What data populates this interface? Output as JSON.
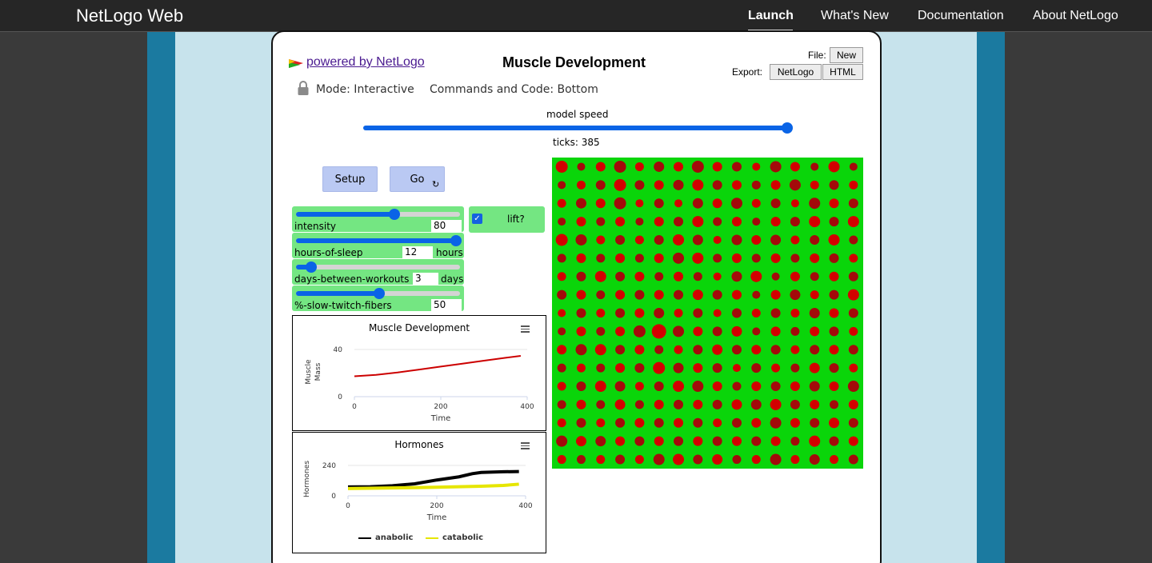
{
  "navbar": {
    "brand": "NetLogo Web",
    "links": [
      "Launch",
      "What's New",
      "Documentation",
      "About NetLogo"
    ]
  },
  "header": {
    "powered_by": "powered by NetLogo",
    "title": "Muscle Development",
    "file_label": "File:",
    "new_button": "New",
    "export_label": "Export:",
    "export_netlogo": "NetLogo",
    "export_html": "HTML",
    "mode": "Mode: Interactive",
    "commands": "Commands and Code: Bottom"
  },
  "speed": {
    "label": "model speed",
    "ticks": "ticks: 385",
    "value": 1.0
  },
  "buttons": {
    "setup": "Setup",
    "go": "Go",
    "go_icon": "forever-icon"
  },
  "sliders": [
    {
      "name": "intensity",
      "value": "80",
      "units": "",
      "fraction": 0.6
    },
    {
      "name": "hours-of-sleep",
      "value": "12",
      "units": "hours",
      "fraction": 1.0
    },
    {
      "name": "days-between-workouts",
      "value": "3",
      "units": "days",
      "fraction": 0.1
    },
    {
      "name": "%-slow-twitch-fibers",
      "value": "50",
      "units": "",
      "fraction": 0.5
    }
  ],
  "switch": {
    "label": "lift?",
    "checked": true
  },
  "plots": {
    "muscle": {
      "title": "Muscle Development",
      "ylabel_line1": "Muscle",
      "ylabel_line2": "Mass",
      "xlabel": "Time",
      "y_ticks": [
        "40",
        "0"
      ],
      "x_ticks": [
        "0",
        "200",
        "400"
      ]
    },
    "hormones": {
      "title": "Hormones",
      "ylabel": "Hormones",
      "xlabel": "Time",
      "y_ticks": [
        "240",
        "0"
      ],
      "x_ticks": [
        "0",
        "200",
        "400"
      ],
      "legend": [
        "anabolic",
        "catabolic"
      ]
    }
  },
  "chart_data": [
    {
      "type": "line",
      "title": "Muscle Development",
      "xlabel": "Time",
      "ylabel": "Muscle Mass",
      "xlim": [
        0,
        400
      ],
      "ylim": [
        0,
        40
      ],
      "series": [
        {
          "color": "#cc0000",
          "x": [
            0,
            50,
            100,
            150,
            200,
            250,
            300,
            350,
            385
          ],
          "y": [
            17.3,
            18.5,
            20.5,
            23,
            25.5,
            28,
            30.5,
            33,
            34.6
          ]
        }
      ]
    },
    {
      "type": "line",
      "title": "Hormones",
      "xlabel": "Time",
      "ylabel": "Hormones",
      "xlim": [
        0,
        400
      ],
      "ylim": [
        0,
        240
      ],
      "series": [
        {
          "name": "anabolic",
          "color": "#000000",
          "x": [
            0,
            50,
            100,
            150,
            200,
            250,
            280,
            300,
            350,
            385
          ],
          "y": [
            70,
            72,
            80,
            95,
            125,
            150,
            175,
            185,
            190,
            192
          ]
        },
        {
          "name": "catabolic",
          "color": "#e6e600",
          "x": [
            0,
            50,
            100,
            150,
            200,
            250,
            300,
            350,
            385
          ],
          "y": [
            58,
            60,
            62,
            65,
            68,
            72,
            76,
            82,
            92
          ]
        }
      ]
    }
  ],
  "view": {
    "background": "#0ad50a",
    "colors": [
      "#d30000",
      "#a30a0a"
    ],
    "sizes": [
      [
        15,
        10,
        12,
        15,
        11,
        13,
        12,
        15,
        12,
        12,
        10,
        14,
        12,
        10,
        14,
        10
      ],
      [
        10,
        11,
        12,
        15,
        12,
        12,
        13,
        14,
        12,
        12,
        11,
        12,
        14,
        11,
        12,
        11
      ],
      [
        11,
        13,
        12,
        15,
        10,
        12,
        10,
        13,
        12,
        14,
        11,
        12,
        10,
        14,
        12,
        12
      ],
      [
        10,
        12,
        11,
        12,
        10,
        12,
        12,
        14,
        11,
        12,
        10,
        12,
        12,
        14,
        12,
        14
      ],
      [
        15,
        14,
        11,
        12,
        11,
        12,
        14,
        13,
        10,
        13,
        12,
        13,
        11,
        12,
        14,
        11
      ],
      [
        11,
        12,
        11,
        12,
        11,
        12,
        14,
        14,
        11,
        12,
        11,
        12,
        11,
        12,
        12,
        11
      ],
      [
        11,
        12,
        14,
        12,
        12,
        11,
        12,
        11,
        10,
        13,
        14,
        10,
        12,
        11,
        12,
        12
      ],
      [
        12,
        12,
        11,
        12,
        12,
        12,
        12,
        13,
        12,
        12,
        10,
        12,
        13,
        11,
        12,
        14
      ],
      [
        10,
        12,
        11,
        12,
        12,
        13,
        11,
        12,
        10,
        12,
        11,
        12,
        11,
        13,
        12,
        12
      ],
      [
        10,
        12,
        11,
        12,
        15,
        18,
        14,
        12,
        12,
        13,
        10,
        12,
        11,
        12,
        12,
        11
      ],
      [
        12,
        14,
        14,
        12,
        12,
        11,
        11,
        12,
        13,
        12,
        12,
        12,
        11,
        12,
        12,
        12
      ],
      [
        11,
        11,
        11,
        12,
        12,
        15,
        13,
        12,
        12,
        10,
        12,
        11,
        11,
        13,
        12,
        11
      ],
      [
        11,
        12,
        14,
        13,
        11,
        12,
        14,
        14,
        12,
        11,
        12,
        12,
        12,
        13,
        12,
        14
      ],
      [
        11,
        12,
        11,
        13,
        11,
        12,
        12,
        12,
        12,
        13,
        13,
        14,
        12,
        12,
        11,
        12
      ],
      [
        11,
        12,
        11,
        12,
        12,
        12,
        12,
        12,
        11,
        12,
        12,
        14,
        12,
        12,
        13,
        12
      ],
      [
        14,
        13,
        13,
        12,
        12,
        12,
        12,
        12,
        12,
        12,
        12,
        12,
        11,
        14,
        12,
        12
      ],
      [
        11,
        11,
        11,
        12,
        11,
        14,
        14,
        12,
        13,
        11,
        11,
        14,
        11,
        13,
        11,
        12
      ]
    ]
  }
}
